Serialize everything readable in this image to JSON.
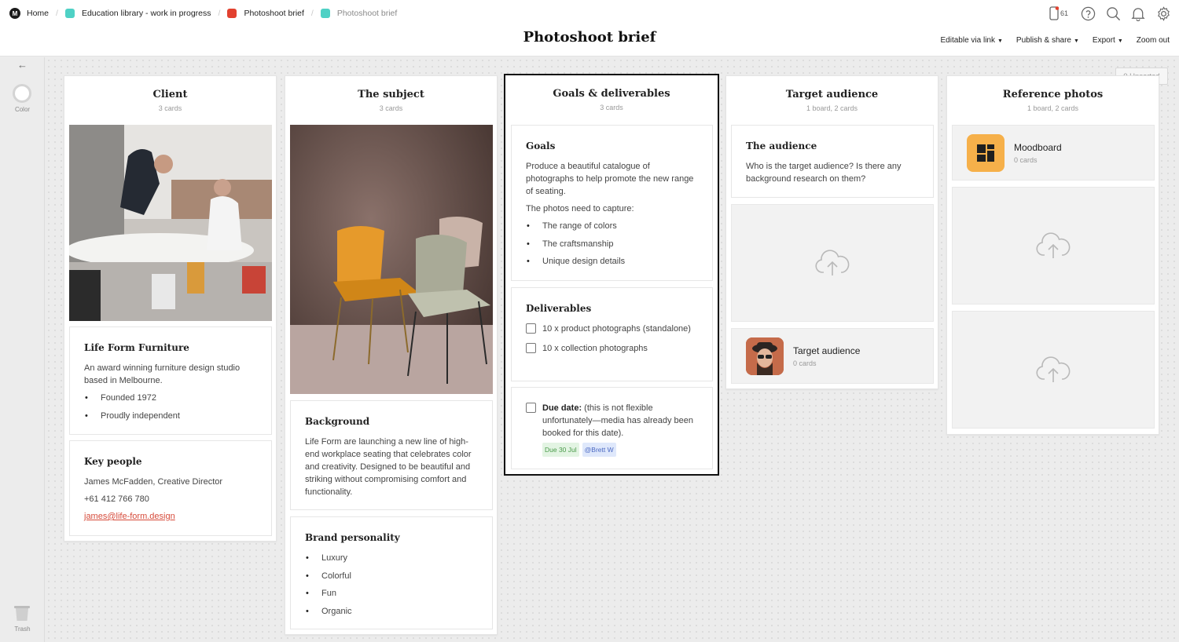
{
  "breadcrumbs": [
    {
      "label": "Home",
      "color": ""
    },
    {
      "label": "Education library - work in progress",
      "color": "#4fd1c5"
    },
    {
      "label": "Photoshoot brief",
      "color": "#e2412f"
    },
    {
      "label": "Photoshoot brief",
      "color": "#4fd1c5"
    }
  ],
  "page_title": "Photoshoot brief",
  "header": {
    "device_count": "61",
    "menus": {
      "editable": "Editable via link",
      "publish": "Publish & share",
      "export": "Export",
      "zoom": "Zoom out"
    }
  },
  "rail": {
    "color_label": "Color",
    "trash_label": "Trash"
  },
  "unsorted": "0 Unsorted",
  "columns": {
    "client": {
      "title": "Client",
      "subtitle": "3 cards",
      "company": {
        "title": "Life Form Furniture",
        "text": "An award winning furniture design studio based in Melbourne.",
        "bullets": [
          "Founded 1972",
          "Proudly independent"
        ]
      },
      "people": {
        "title": "Key people",
        "name": "James McFadden, Creative Director",
        "phone": "+61 412 766 780",
        "email": "james@life-form.design"
      }
    },
    "subject": {
      "title": "The subject",
      "subtitle": "3 cards",
      "background": {
        "title": "Background",
        "text": "Life Form are launching a new line of high-end workplace seating that celebrates color and creativity. Designed to be beautiful and striking without compromising comfort and functionality."
      },
      "personality": {
        "title": "Brand personality",
        "bullets": [
          "Luxury",
          "Colorful",
          "Fun",
          "Organic"
        ]
      }
    },
    "goals": {
      "title": "Goals & deliverables",
      "subtitle": "3 cards",
      "goals_card": {
        "title": "Goals",
        "text": "Produce a beautiful catalogue of photographs to help promote the new range of seating.",
        "text2": "The photos need to capture:",
        "bullets": [
          "The range of colors",
          "The craftsmanship",
          "Unique design details"
        ]
      },
      "deliverables": {
        "title": "Deliverables",
        "items": [
          "10 x product photographs (standalone)",
          "10 x collection photographs"
        ]
      },
      "due": {
        "bold": "Due date:",
        "text": " (this is not flexible unfortunately—media has already been booked for this date).",
        "due_tag": "Due 30 Jul",
        "mention_tag": "@Brett W"
      }
    },
    "audience": {
      "title": "Target audience",
      "subtitle": "1 board, 2 cards",
      "note": {
        "title": "The audience",
        "text": "Who is the target audience? Is there any background research on them?"
      },
      "board": {
        "name": "Target audience",
        "count": "0 cards"
      }
    },
    "reference": {
      "title": "Reference photos",
      "subtitle": "1 board, 2 cards",
      "board": {
        "name": "Moodboard",
        "count": "0 cards"
      }
    }
  },
  "icons": [
    "logo-icon",
    "device-icon",
    "help-icon",
    "search-icon",
    "bell-icon",
    "gear-icon",
    "back-arrow-icon",
    "trash-icon",
    "upload-cloud-icon",
    "moodboard-icon"
  ]
}
